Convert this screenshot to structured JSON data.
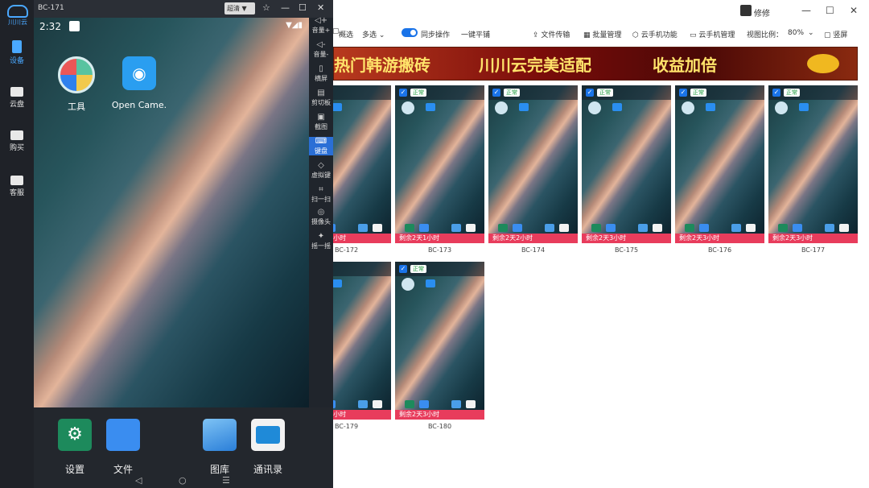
{
  "left_nav": {
    "logo": "川川云",
    "items": [
      {
        "label": "设备",
        "active": true
      },
      {
        "label": "云盘"
      },
      {
        "label": "购买"
      },
      {
        "label": "客服"
      }
    ]
  },
  "phone": {
    "title": "BC-171",
    "quality": "超清 ▼",
    "status": {
      "time": "2:32",
      "icons": "▼◢▮"
    },
    "apps": [
      {
        "label": "工具",
        "icon": "tools-folder-icon"
      },
      {
        "label": "Open Came.",
        "icon": "camera-icon"
      }
    ],
    "dock": [
      {
        "label": "设置",
        "icon": "settings-icon",
        "color": "#1d8a5c"
      },
      {
        "label": "文件",
        "icon": "folder-icon",
        "color": "#3a8df0"
      },
      {
        "label": "图库",
        "icon": "gallery-icon",
        "color": "#4a9ee8"
      },
      {
        "label": "通讯录",
        "icon": "contacts-icon",
        "color": "#f2f2f2"
      }
    ],
    "nav": [
      "◁",
      "○",
      "☰"
    ]
  },
  "side_tools": [
    {
      "label": "音量+",
      "glyph": "◁+"
    },
    {
      "label": "音量-",
      "glyph": "◁-"
    },
    {
      "label": "横屏",
      "glyph": "▯"
    },
    {
      "label": "剪切板",
      "glyph": "▤"
    },
    {
      "label": "截图",
      "glyph": "▣"
    },
    {
      "label": "键盘",
      "glyph": "⌨",
      "active": true
    },
    {
      "label": "虚拟键",
      "glyph": "◇"
    },
    {
      "label": "扫一扫",
      "glyph": "⌗"
    },
    {
      "label": "摄像头",
      "glyph": "◎"
    },
    {
      "label": "摇一摇",
      "glyph": "✦"
    }
  ],
  "window": {
    "user": "修修",
    "controls": [
      "—",
      "☐",
      "✕"
    ]
  },
  "toolbar": {
    "check": "▢",
    "invert": "概选",
    "multi": "多选 ⌄",
    "sync": "同步操作",
    "tile": "一键平铺",
    "transfer": "⇪ 文件传输",
    "batch": "▦ 批量管理",
    "cloud_fn": "⬡ 云手机功能",
    "cloud_mgr": "▭ 云手机管理",
    "ratio_label": "视图比例：",
    "ratio": "80%",
    "portrait": "▢ 竖屏"
  },
  "banner": {
    "text1": "热门韩游搬砖",
    "text2": "川川云完美适配",
    "text3": "收益加倍"
  },
  "cards": [
    {
      "name": "BC-172",
      "status": "正常",
      "remain": "剩余2天1小时"
    },
    {
      "name": "BC-173",
      "status": "正常",
      "remain": "剩余2天1小时"
    },
    {
      "name": "BC-174",
      "status": "正常",
      "remain": "剩余2天2小时"
    },
    {
      "name": "BC-175",
      "status": "正常",
      "remain": "剩余2天3小时"
    },
    {
      "name": "BC-176",
      "status": "正常",
      "remain": "剩余2天3小时"
    },
    {
      "name": "BC-177",
      "status": "正常",
      "remain": "剩余2天3小时"
    },
    {
      "name": "BC-179",
      "status": "正常",
      "remain": "剩余2天3小时"
    },
    {
      "name": "BC-180",
      "status": "正常",
      "remain": "剩余2天3小时"
    }
  ]
}
